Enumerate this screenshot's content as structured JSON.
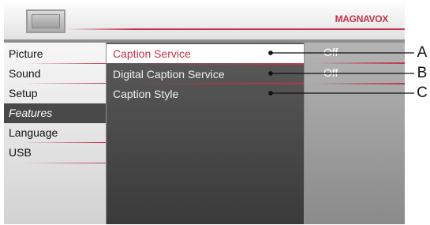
{
  "header": {
    "brand": "MAGNAVOX",
    "icon": "tv-icon"
  },
  "sidebar": {
    "items": [
      {
        "label": "Picture",
        "selected": false
      },
      {
        "label": "Sound",
        "selected": false
      },
      {
        "label": "Setup",
        "selected": false
      },
      {
        "label": "Features",
        "selected": true
      },
      {
        "label": "Language",
        "selected": false
      },
      {
        "label": "USB",
        "selected": false
      }
    ]
  },
  "submenu": {
    "items": [
      {
        "label": "Caption Service",
        "selected": true
      },
      {
        "label": "Digital Caption Service",
        "selected": false
      },
      {
        "label": "Caption Style",
        "selected": false
      }
    ]
  },
  "values": {
    "items": [
      {
        "label": "Off"
      },
      {
        "label": "Off"
      }
    ]
  },
  "callouts": [
    "A",
    "B",
    "C"
  ],
  "colors": {
    "accent": "#c43249",
    "selected_sidebar_bg": "#494949",
    "submenu_bg": "#4a4a4a"
  }
}
